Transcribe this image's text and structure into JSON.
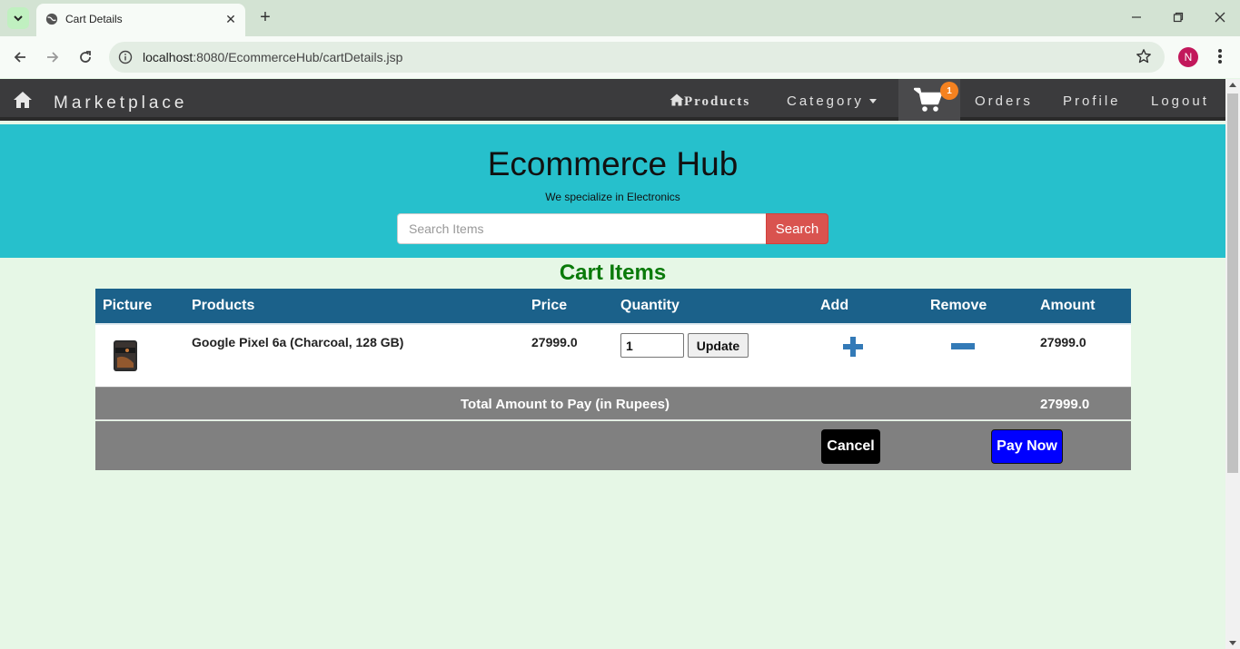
{
  "browser": {
    "tab_title": "Cart Details",
    "url_host": "localhost",
    "url_path": ":8080/EcommerceHub/cartDetails.jsp",
    "profile_initial": "N"
  },
  "navbar": {
    "brand": "Marketplace",
    "products": "Products",
    "category": "Category",
    "cart_count": "1",
    "orders": "Orders",
    "profile": "Profile",
    "logout": "Logout"
  },
  "hero": {
    "title": "Ecommerce Hub",
    "tagline": "We specialize in Electronics",
    "search_placeholder": "Search Items",
    "search_button": "Search"
  },
  "cart": {
    "heading": "Cart Items",
    "columns": [
      "Picture",
      "Products",
      "Price",
      "Quantity",
      "Add",
      "Remove",
      "Amount"
    ],
    "items": [
      {
        "product": "Google Pixel 6a (Charcoal, 128 GB)",
        "price": "27999.0",
        "quantity": "1",
        "update_label": "Update",
        "amount": "27999.0"
      }
    ],
    "total_label": "Total Amount to Pay (in Rupees)",
    "total_value": "27999.0",
    "cancel_label": "Cancel",
    "pay_label": "Pay Now"
  },
  "colors": {
    "navbar_bg": "#3b3b3d",
    "hero_bg": "#26c0cc",
    "table_header_bg": "#1b618a",
    "heading_green": "#0a7a0a",
    "cart_badge": "#f58220",
    "pay_button": "#0000ff",
    "search_button": "#d9534f"
  }
}
